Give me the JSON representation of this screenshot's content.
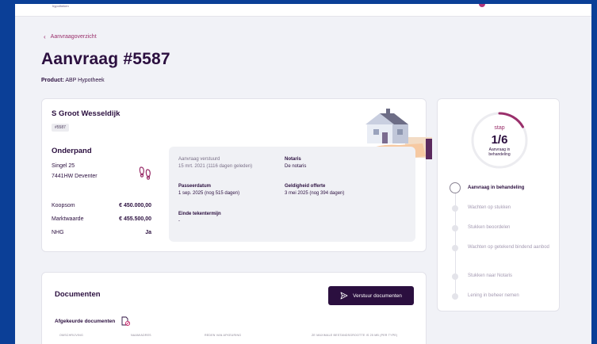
{
  "header": {
    "logo_sub": "hypotheken"
  },
  "breadcrumb": {
    "back_label": "Aanvraagoverzicht"
  },
  "page": {
    "title": "Aanvraag #5587",
    "product_label": "Product:",
    "product_value": "ABP Hypotheek"
  },
  "client": {
    "name": "S Groot Wesseldijk",
    "id_badge": "#5587",
    "onderpand_title": "Onderpand",
    "address_line1": "Singel 25",
    "address_line2": "7441HW Deventer",
    "financials": [
      {
        "label": "Koopsom",
        "value": "€ 450.000,00"
      },
      {
        "label": "Marktwaarde",
        "value": "€ 455.500,00"
      },
      {
        "label": "NHG",
        "value": "Ja"
      }
    ]
  },
  "info": {
    "verstuurd_label": "Aanvraag verstuurd",
    "verstuurd_value": "15 mrt. 2021 (1116 dagen geleden)",
    "notaris_label": "Notaris",
    "notaris_value": "De notaris",
    "passeer_label": "Passeerdatum",
    "passeer_value": "1 sep. 2025 (nog 515 dagen)",
    "geldigheid_label": "Geldigheid offerte",
    "geldigheid_value": "3 mei 2025 (nog 394 dagen)",
    "einde_label": "Einde tekentermijn",
    "einde_value": "-"
  },
  "progress": {
    "stap_label": "stap",
    "current": 1,
    "total": 6,
    "fraction_text": "1/6",
    "status_text": "Aanvraag in behandeling",
    "accent_color": "#9a2f6b",
    "steps": [
      {
        "label": "Aanvraag in behandeling",
        "active": true
      },
      {
        "label": "Wachten op stukken",
        "active": false
      },
      {
        "label": "Stukken beoordelen",
        "active": false
      },
      {
        "label": "Wachten op getekend bindend aanbod",
        "active": false
      },
      {
        "label": "Stukken naar Notaris",
        "active": false
      },
      {
        "label": "Lening in beheer nemen",
        "active": false
      }
    ]
  },
  "documents": {
    "title": "Documenten",
    "send_button": "Verstuur documenten",
    "rejected_title": "Afgekeurde documenten",
    "columns": [
      "OMSCHRIJVING",
      "NAAM/ADRES",
      "REDEN VAN AFKEURING",
      "ZE MAXIMALE BESTANDSGROOTTE IS 25 MB (PER TYPE)"
    ]
  },
  "colors": {
    "primary": "#2b0f3f",
    "accent": "#9a2f6b",
    "background": "#f1f2f7",
    "frame": "#0b3f97"
  }
}
